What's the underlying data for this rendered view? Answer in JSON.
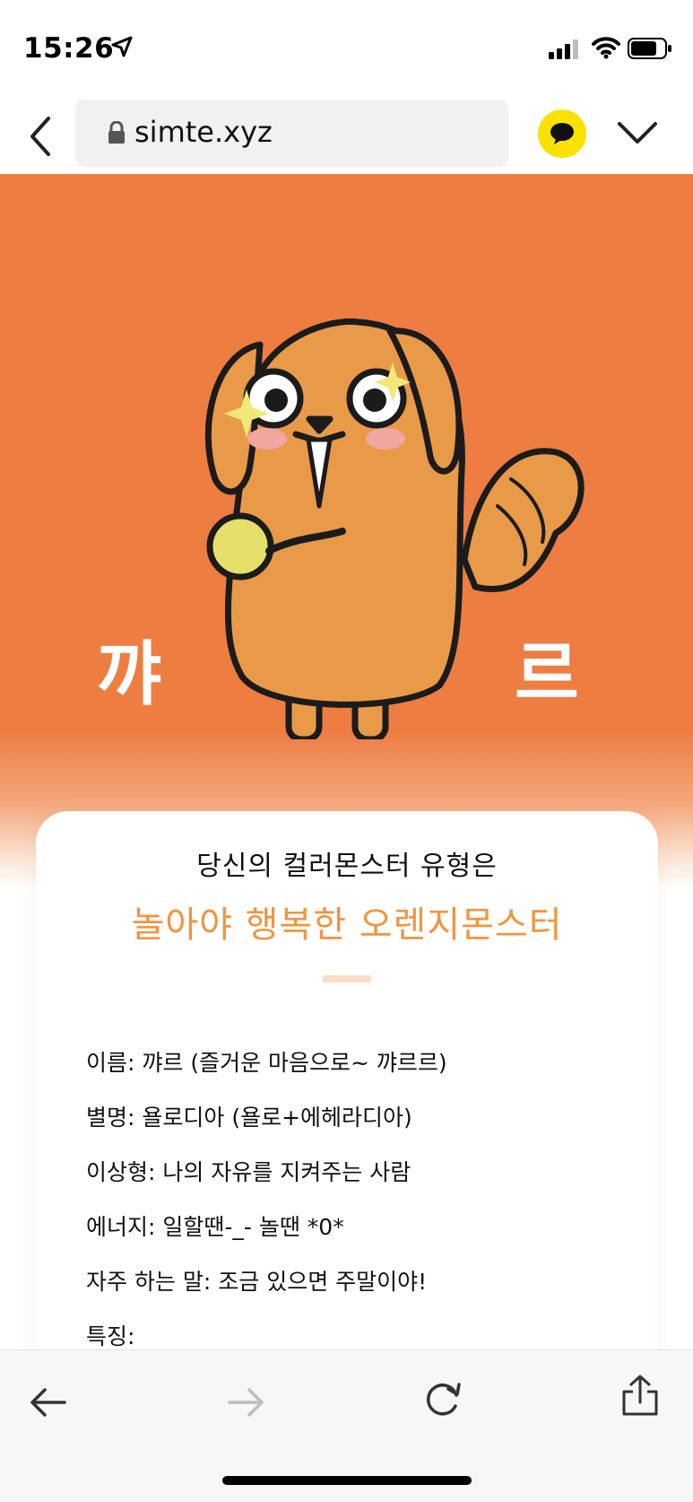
{
  "status_bar": {
    "time": "15:26",
    "icons": [
      "location-arrow-icon",
      "cellular-signal-icon",
      "wifi-icon",
      "battery-icon"
    ]
  },
  "browser": {
    "url": "simte.xyz",
    "icons": [
      "back-chevron-icon",
      "lock-icon",
      "kakaotalk-icon",
      "chevron-down-icon"
    ],
    "kakao_color": "#fae100"
  },
  "hero": {
    "background_color": "#ee7d42",
    "character_name_left": "꺄",
    "character_name_right": "르"
  },
  "result": {
    "subtitle": "당신의 컬러몬스터 유형은",
    "title": "놀아야 행복한 오렌지몬스터",
    "title_color": "#f29441",
    "details": [
      "이름: 꺄르 (즐거운 마음으로~ 꺄르르)",
      "별명: 욜로디아 (욜로+에헤라디아)",
      "이상형: 나의 자유를 지켜주는 사람",
      "에너지: 일할땐-_-  놀땐 *0*",
      "자주 하는 말: 조금 있으면 주말이야!",
      "특징:"
    ]
  },
  "toolbar": {
    "icons": [
      "back-arrow-icon",
      "forward-arrow-icon",
      "reload-icon",
      "share-icon"
    ]
  }
}
